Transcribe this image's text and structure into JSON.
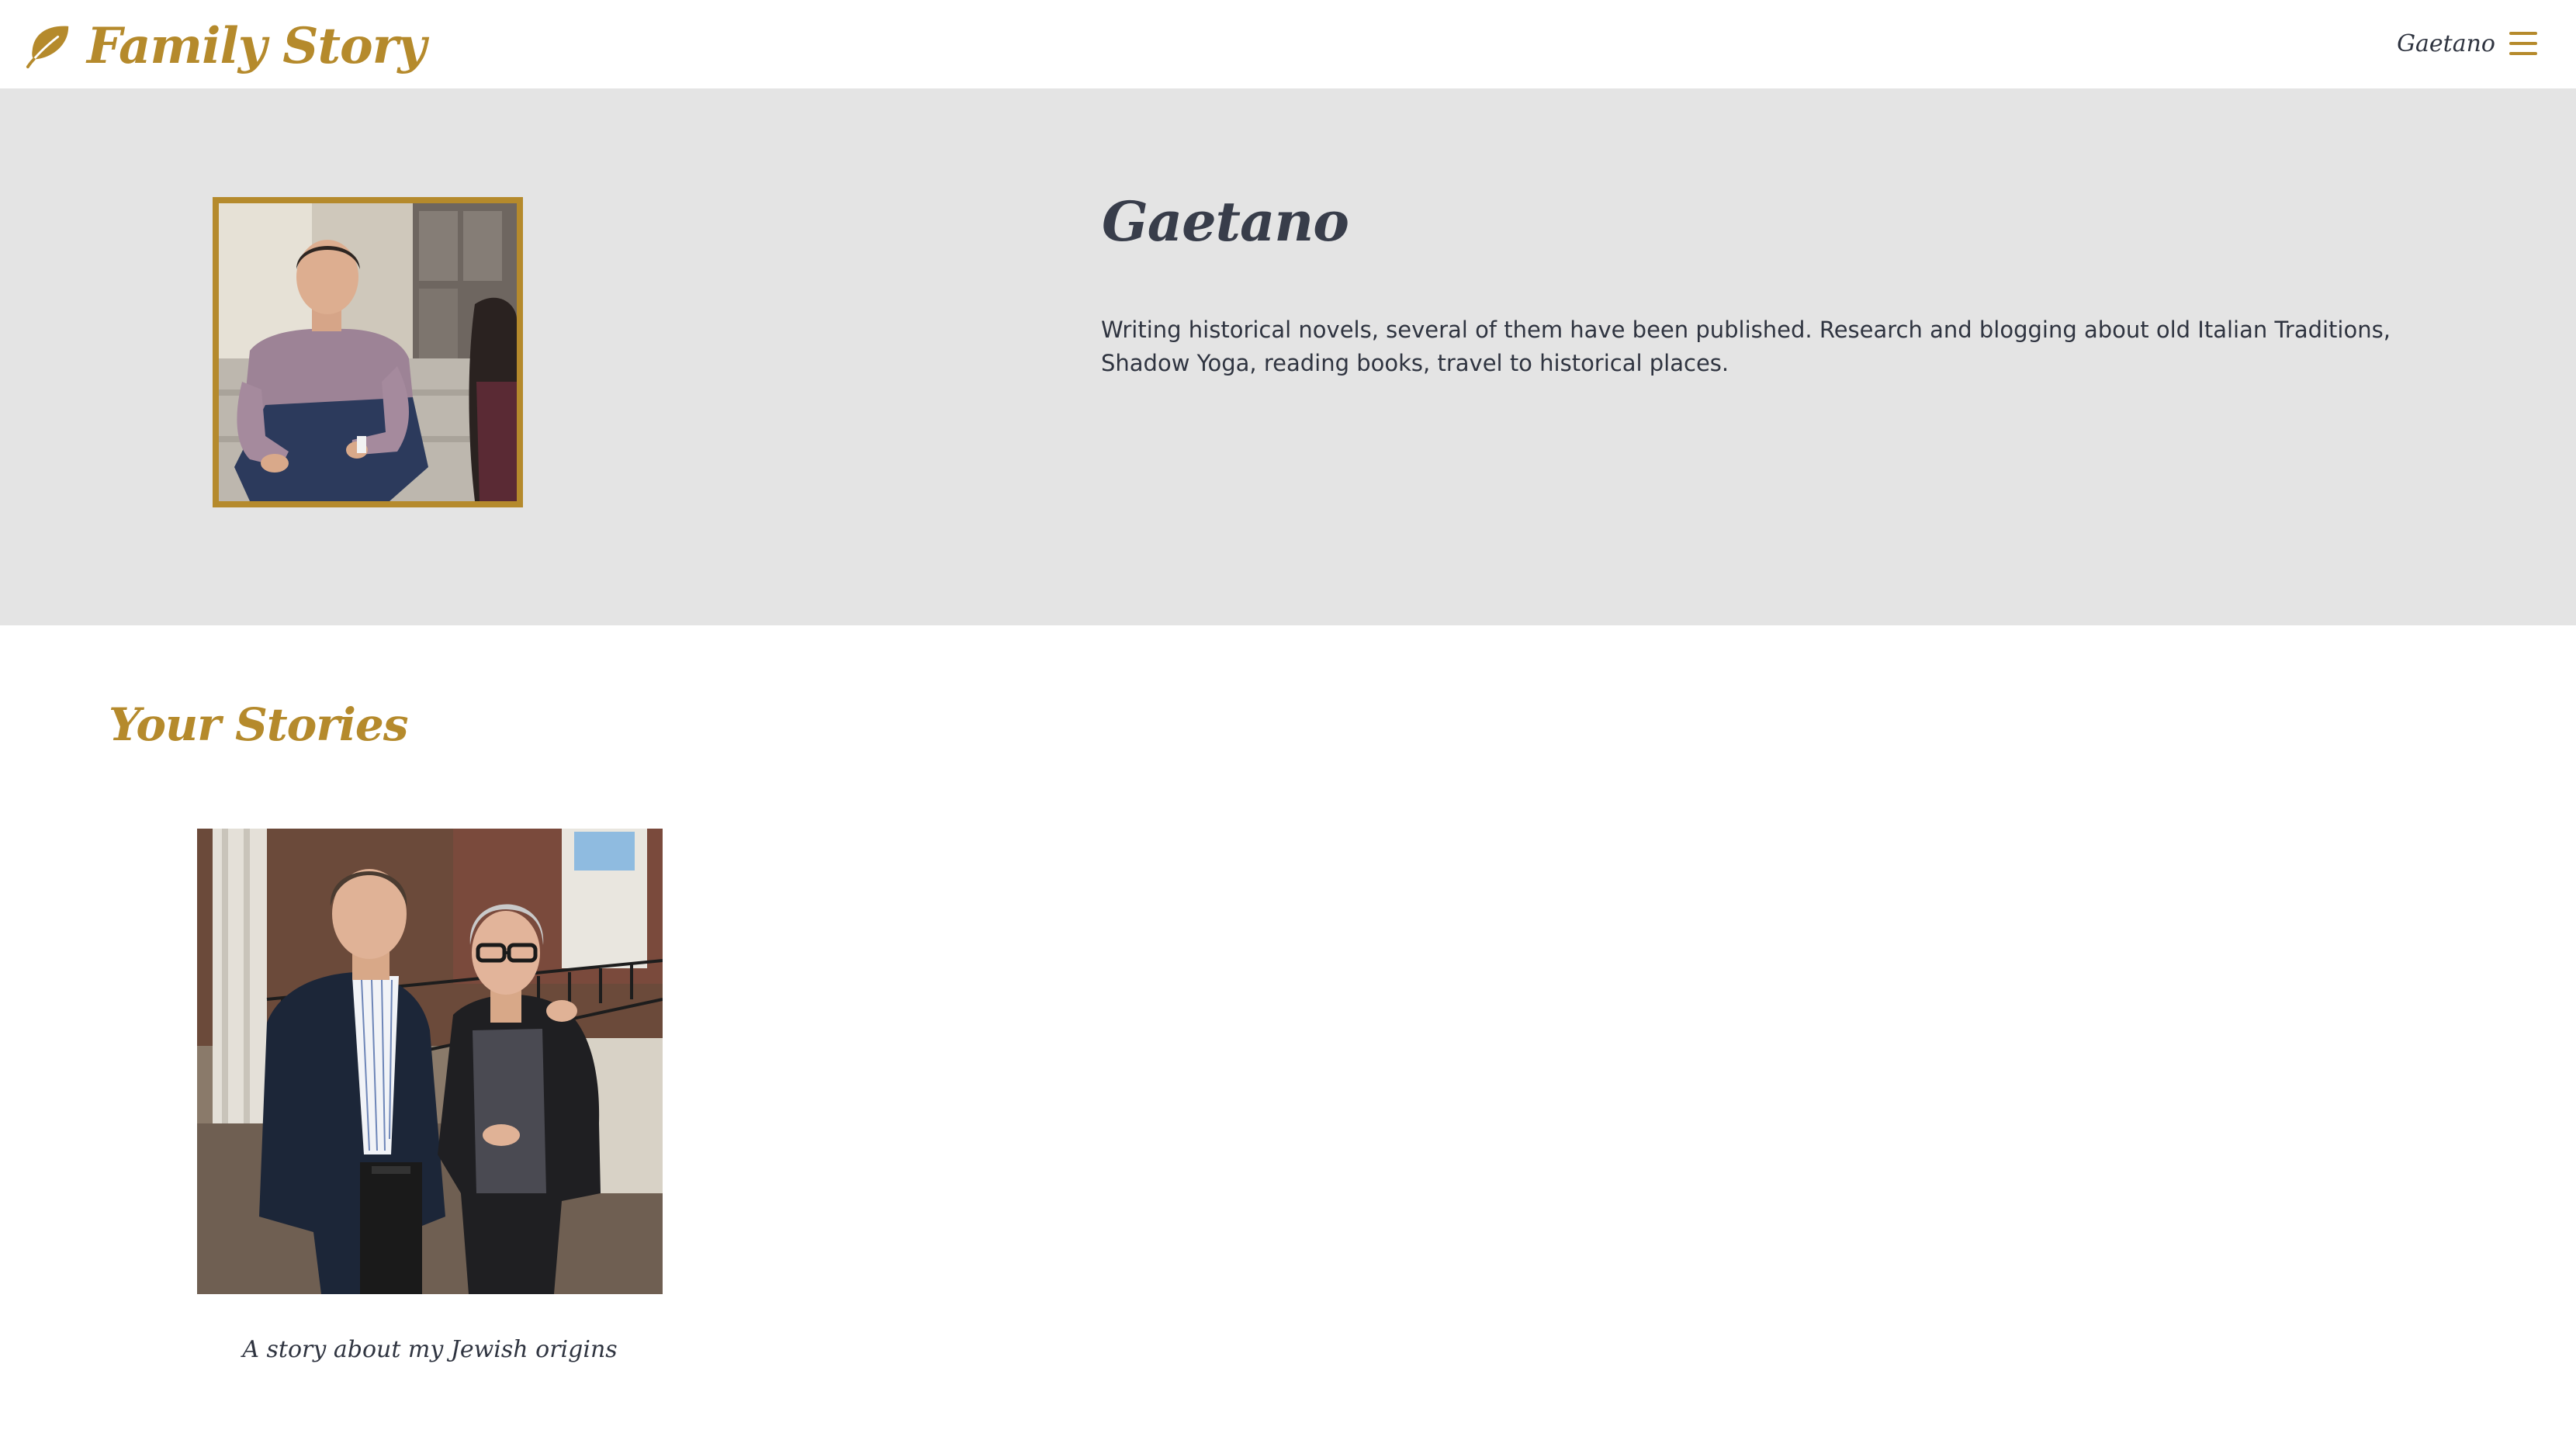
{
  "header": {
    "brand_title": "Family Story",
    "brand_icon": "leaf-icon",
    "user_name": "Gaetano",
    "menu_icon": "hamburger-menu-icon"
  },
  "profile": {
    "name": "Gaetano",
    "bio": "Writing historical novels, several of them have been published. Research and blogging about old Italian Traditions, Shadow Yoga, reading books, travel to historical places."
  },
  "stories": {
    "title": "Your Stories",
    "items": [
      {
        "caption": "A story about my Jewish origins"
      }
    ]
  },
  "colors": {
    "accent": "#b58a2c",
    "text": "#2f3440",
    "band": "#e4e4e4"
  }
}
